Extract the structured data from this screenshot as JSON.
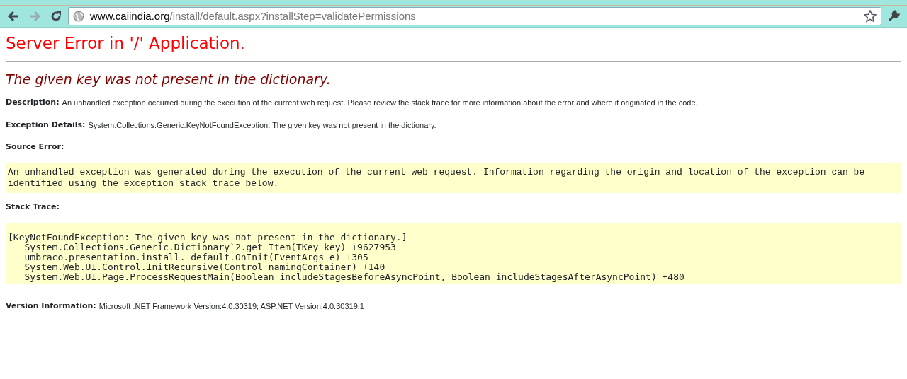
{
  "toolbar": {
    "back": {
      "disabled": false
    },
    "forward": {
      "disabled": true
    },
    "url_host": "www.caiindia.org",
    "url_path": "/install/default.aspx?installStep=validatePermissions"
  },
  "page": {
    "title": "Server Error in '/' Application.",
    "message": "The given key was not present in the dictionary.",
    "sections": [
      {
        "kind": "field",
        "label": "Description:",
        "text": "An unhandled exception occurred during the execution of the current web request. Please review the stack trace for more information about the error and where it originated in the code."
      },
      {
        "kind": "field",
        "label": "Exception Details:",
        "text": "System.Collections.Generic.KeyNotFoundException: The given key was not present in the dictionary."
      },
      {
        "kind": "heading",
        "label": "Source Error:"
      },
      {
        "kind": "source",
        "lines": [
          "An unhandled exception was generated during the execution of the current web request. Information regarding the origin and location of the exception can be",
          "identified using the exception stack trace below."
        ]
      },
      {
        "kind": "heading",
        "label": "Stack Trace:"
      },
      {
        "kind": "stack",
        "lines": [
          "[KeyNotFoundException: The given key was not present in the dictionary.]",
          "   System.Collections.Generic.Dictionary`2.get_Item(TKey key) +9627953",
          "   umbraco.presentation.install._default.OnInit(EventArgs e) +305",
          "   System.Web.UI.Control.InitRecursive(Control namingContainer) +140",
          "   System.Web.UI.Page.ProcessRequestMain(Boolean includeStagesBeforeAsyncPoint, Boolean includeStagesAfterAsyncPoint) +480"
        ]
      },
      {
        "kind": "rule"
      },
      {
        "kind": "field",
        "label": "Version Information:",
        "text": "Microsoft .NET Framework Version:4.0.30319; ASP.NET Version:4.0.30319.1"
      }
    ]
  }
}
